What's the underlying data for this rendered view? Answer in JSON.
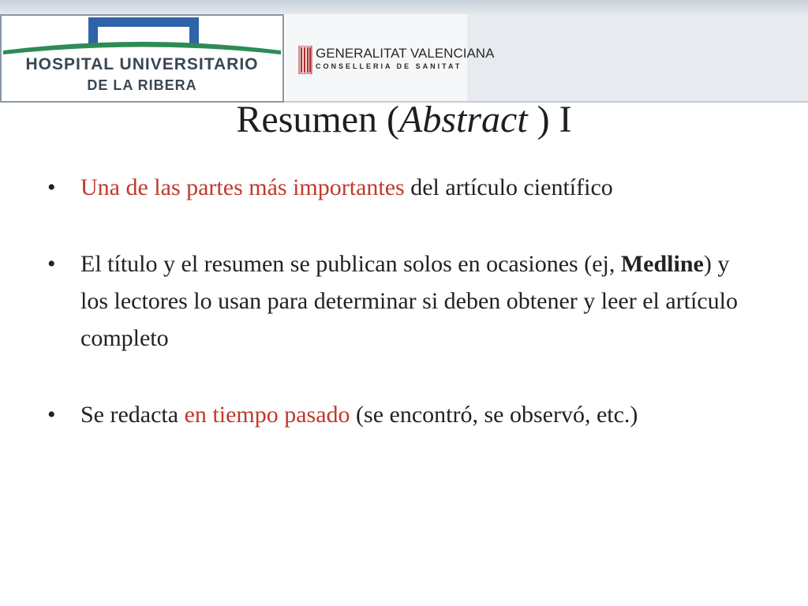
{
  "header": {
    "hospital_logo": {
      "line1": "Hospital Universitario",
      "line2": "de La Ribera"
    },
    "gva_logo": {
      "name": "GENERALITAT VALENCIANA",
      "sub": "CONSELLERIA DE SANITAT"
    }
  },
  "slide": {
    "title_main": "Resumen (",
    "title_italic": "Abstract",
    "title_tail": " ) I",
    "bullets": [
      {
        "highlight": "Una de las partes más importantes",
        "rest": " del artículo científico"
      },
      {
        "text_a": "El título y el resumen se publican solos en ocasiones (ej, ",
        "bold": "Medline",
        "text_b": ") y los lectores lo usan para determinar si deben obtener y leer el artículo completo"
      },
      {
        "text_a": "Se redacta ",
        "highlight": "en tiempo pasado",
        "text_b": " (se encontró, se observó, etc.)"
      }
    ]
  },
  "colors": {
    "highlight": "#c0392b",
    "logo_blue": "#2f63a8",
    "logo_green": "#2e8b57"
  }
}
